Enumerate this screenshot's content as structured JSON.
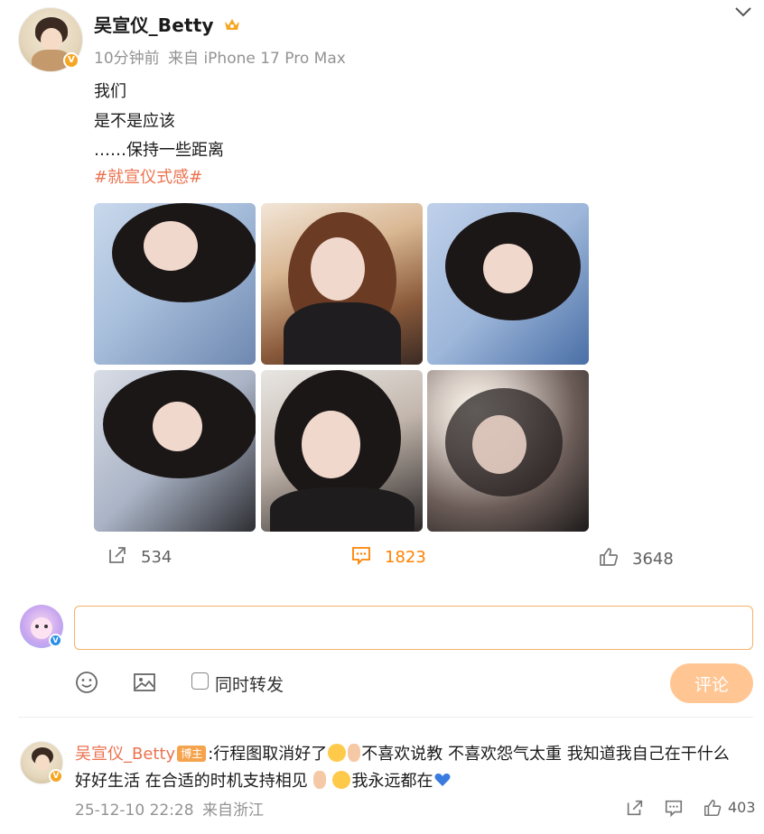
{
  "post": {
    "author": "吴宣仪_Betty",
    "time": "10分钟前",
    "source": "来自 iPhone 17 Pro Max",
    "lines": [
      "我们",
      "是不是应该",
      "……保持一些距离"
    ],
    "hashtag": "#就宣仪式感#",
    "photos_count": 6
  },
  "actions": {
    "repost_count": "534",
    "comment_count": "1823",
    "like_count": "3648"
  },
  "composer": {
    "placeholder": "",
    "repost_option_label": "同时转发",
    "submit_label": "评论"
  },
  "comment": {
    "author": "吴宣仪_Betty",
    "badge": "博主",
    "separator": ":",
    "text_1": "行程图取消好了",
    "text_2": "不喜欢说教 不喜欢怨气太重 我知道我自己在干什么",
    "text_3": "好好生活 在合适的时机支持相见",
    "text_4": "我永远都在",
    "date": "25-12-10 22:28",
    "location": "来自浙江",
    "like_count": "403"
  },
  "colors": {
    "accent": "#ff8200",
    "link": "#eb7350",
    "muted": "#939393",
    "submit_bg": "#ffc694"
  },
  "icons": {
    "repost": "repost-icon",
    "comment": "comment-icon",
    "like": "thumbs-up-icon",
    "emoji": "smile-icon",
    "image": "image-icon",
    "expand": "chevron-down-icon"
  }
}
